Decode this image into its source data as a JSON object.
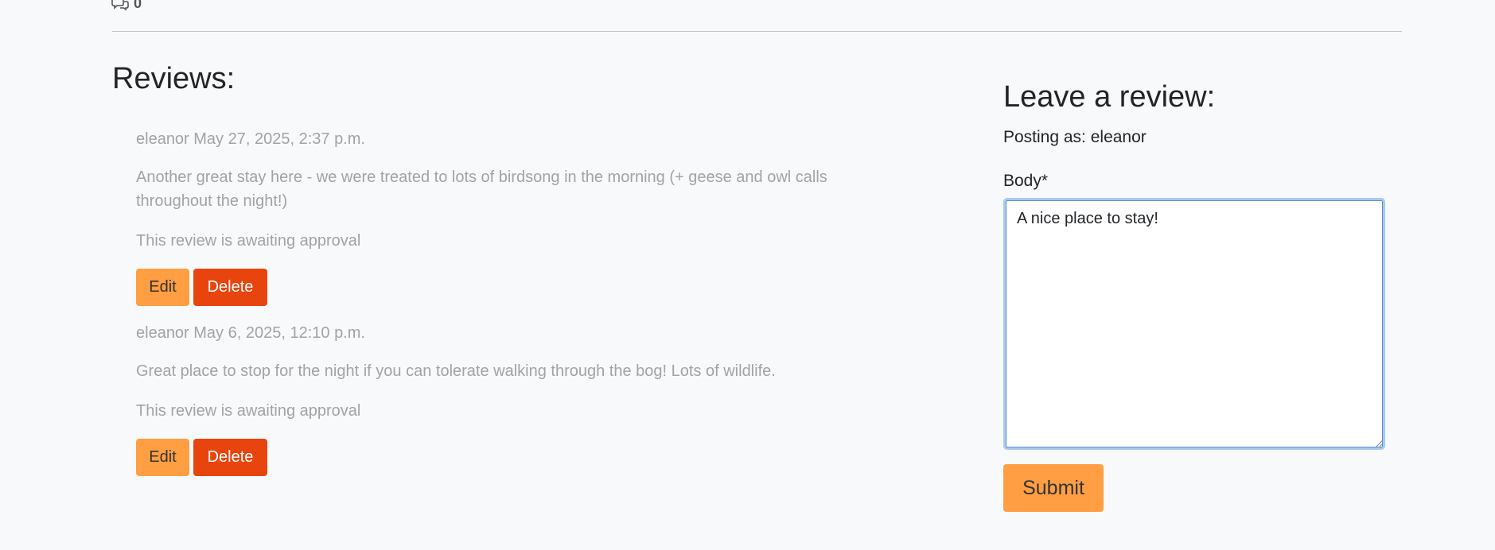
{
  "header": {
    "comment_count": "0",
    "comment_icon": "chat-bubbles-icon"
  },
  "reviews": {
    "title": "Reviews:",
    "items": [
      {
        "meta": "eleanor May 27, 2025, 2:37 p.m.",
        "body": "Another great stay here - we were treated to lots of birdsong in the morning (+ geese and owl calls throughout the night!)",
        "status": "This review is awaiting approval",
        "edit_label": "Edit",
        "delete_label": "Delete"
      },
      {
        "meta": "eleanor May 6, 2025, 12:10 p.m.",
        "body": "Great place to stop for the night if you can tolerate walking through the bog! Lots of wildlife.",
        "status": "This review is awaiting approval",
        "edit_label": "Edit",
        "delete_label": "Delete"
      }
    ]
  },
  "form": {
    "title": "Leave a review:",
    "posting_as": "Posting as: eleanor",
    "body_label": "Body*",
    "body_value": "A nice place to stay!",
    "submit_label": "Submit"
  },
  "colors": {
    "edit_button": "#ff9e42",
    "delete_button": "#e8450e",
    "submit_button": "#ff9e42",
    "muted_text": "#a3a3a3",
    "background": "#f8f9fa"
  }
}
